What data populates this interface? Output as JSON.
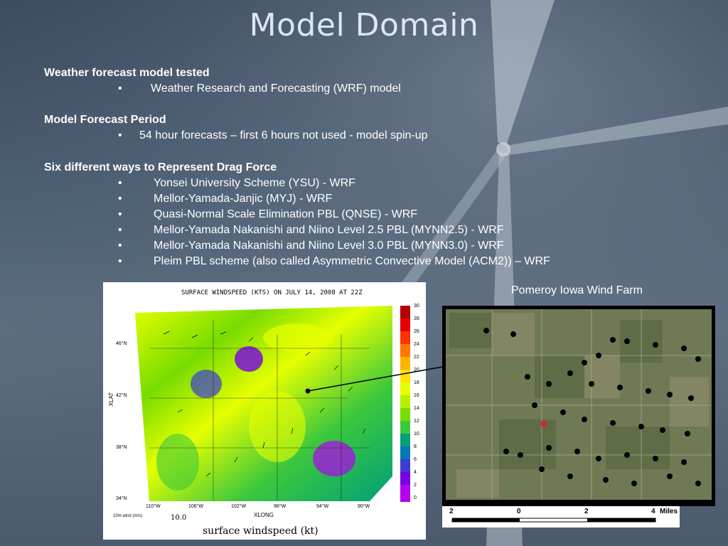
{
  "slide": {
    "title": "Model Domain",
    "sections": [
      {
        "heading": "Weather forecast model tested",
        "bullets": [
          "Weather Research and Forecasting (WRF) model"
        ]
      },
      {
        "heading": "Model Forecast Period",
        "bullets": [
          "54 hour forecasts – first 6 hours not used - model spin-up"
        ]
      },
      {
        "heading": "Six different ways to Represent Drag Force",
        "bullets": [
          "Yonsei University Scheme (YSU) - WRF",
          "Mellor-Yamada-Janjic (MYJ) - WRF",
          "Quasi-Normal Scale Elimination PBL (QNSE) - WRF",
          "Mellor-Yamada Nakanishi and Niino Level 2.5 PBL (MYNN2.5) - WRF",
          "Mellor-Yamada Nakanishi and Niino Level 3.0 PBL (MYNN3.0) - WRF",
          "Pleim PBL scheme (also called Asymmetric Convective Model (ACM2)) – WRF"
        ]
      }
    ],
    "bullet_char": "•"
  },
  "windmap": {
    "title": "SURFACE WINDSPEED (KTS) ON JULY 14, 2008 AT 22Z",
    "ylabel": "XLAT",
    "xlabel": "XLONG",
    "yticks": [
      "46°N",
      "42°N",
      "38°N",
      "34°N"
    ],
    "xticks": [
      "110°W",
      "106°W",
      "102°W",
      "98°W",
      "94°W",
      "90°W"
    ],
    "wind_label": "10m wind (m/s)",
    "wind_ref": "10.0",
    "caption": "surface windspeed (kt)",
    "colorbar_labels": [
      "30",
      "28",
      "26",
      "24",
      "22",
      "20",
      "18",
      "16",
      "14",
      "12",
      "10",
      "8",
      "6",
      "4",
      "2",
      "0"
    ],
    "colorbar_colors": [
      "#b40000",
      "#e60000",
      "#ff3200",
      "#ff7800",
      "#ffb400",
      "#ffe000",
      "#e6ff00",
      "#b4f000",
      "#78dc00",
      "#3cc83c",
      "#00a078",
      "#0078b4",
      "#3c3cd2",
      "#7800e6",
      "#b400f0"
    ]
  },
  "farm": {
    "label": "Pomeroy Iowa Wind Farm",
    "scale_labels": [
      "2",
      "0",
      "2",
      "4",
      "Miles"
    ]
  }
}
